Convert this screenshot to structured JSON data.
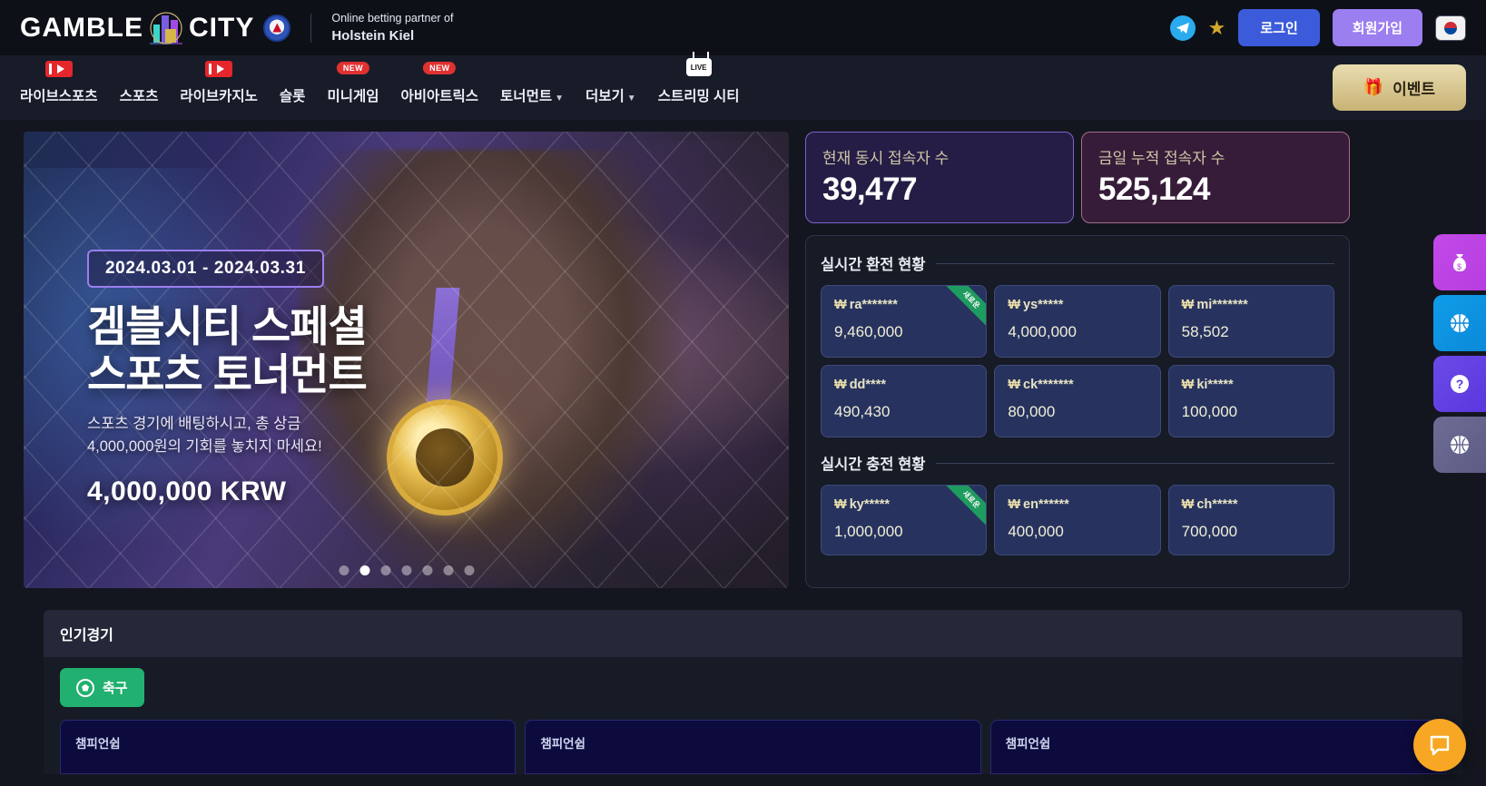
{
  "header": {
    "logo_text_1": "GAMBLE",
    "logo_text_2": "CITY",
    "logo_city_icon": "city-skyline-icon",
    "club_badge_icon": "holstein-kiel-badge-icon",
    "partner_line1": "Online betting partner of",
    "partner_line2": "Holstein Kiel",
    "telegram_icon": "telegram-icon",
    "star_icon": "star-icon",
    "login_label": "로그인",
    "signup_label": "회원가입",
    "flag_icon": "korea-flag-icon"
  },
  "nav": {
    "items": [
      {
        "label": "라이브스포츠",
        "badge": "",
        "badge_type": "youtube",
        "caret": false
      },
      {
        "label": "스포츠",
        "badge": "",
        "badge_type": "",
        "caret": false
      },
      {
        "label": "라이브카지노",
        "badge": "",
        "badge_type": "youtube",
        "caret": false
      },
      {
        "label": "슬롯",
        "badge": "",
        "badge_type": "",
        "caret": false
      },
      {
        "label": "미니게임",
        "badge": "NEW",
        "badge_type": "new",
        "caret": false
      },
      {
        "label": "아비아트릭스",
        "badge": "NEW",
        "badge_type": "new",
        "caret": false
      },
      {
        "label": "토너먼트",
        "badge": "",
        "badge_type": "",
        "caret": true
      },
      {
        "label": "더보기",
        "badge": "",
        "badge_type": "",
        "caret": true
      },
      {
        "label": "스트리밍 시티",
        "badge": "LIVE",
        "badge_type": "tv",
        "caret": false
      }
    ],
    "event_label": "이벤트",
    "event_icon": "gift-icon"
  },
  "banner": {
    "date_range": "2024.03.01 - 2024.03.31",
    "title_line1": "겜블시티 스페셜",
    "title_line2": "스포츠 토너먼트",
    "sub_line1": "스포츠 경기에 배팅하시고, 총 상금",
    "sub_line2": "4,000,000원의 기회를 놓치지 마세요!",
    "prize": "4,000,000 KRW",
    "dots_count": 7,
    "active_dot": 1
  },
  "stats": {
    "current": {
      "label": "현재 동시 접속자 수",
      "value": "39,477",
      "accent": "#7a63c8"
    },
    "today": {
      "label": "금일 누적 접속자 수",
      "value": "525,124",
      "accent": "#a46c8e"
    }
  },
  "withdraw": {
    "title": "실시간 환전 현황",
    "ribbon_label": "새로운",
    "items": [
      {
        "user": "ra*******",
        "amount": "9,460,000",
        "ribbon": true
      },
      {
        "user": "ys*****",
        "amount": "4,000,000",
        "ribbon": false
      },
      {
        "user": "mi*******",
        "amount": "58,502",
        "ribbon": false
      },
      {
        "user": "dd****",
        "amount": "490,430",
        "ribbon": false
      },
      {
        "user": "ck*******",
        "amount": "80,000",
        "ribbon": false
      },
      {
        "user": "ki*****",
        "amount": "100,000",
        "ribbon": false
      }
    ]
  },
  "deposit": {
    "title": "실시간 충전 현황",
    "ribbon_label": "새로운",
    "items": [
      {
        "user": "ky*****",
        "amount": "1,000,000",
        "ribbon": true
      },
      {
        "user": "en******",
        "amount": "400,000",
        "ribbon": false
      },
      {
        "user": "ch*****",
        "amount": "700,000",
        "ribbon": false
      }
    ]
  },
  "popular": {
    "title": "인기경기",
    "tab_label": "축구",
    "tab_icon": "soccer-ball-icon",
    "matches": [
      {
        "league": "챔피언쉽"
      },
      {
        "league": "챔피언쉽"
      },
      {
        "league": "챔피언쉽"
      }
    ]
  },
  "rail": {
    "buttons": [
      {
        "icon": "money-bag-icon",
        "glyph": "💰",
        "color": "#b63de0"
      },
      {
        "icon": "basketball-icon",
        "glyph": "🏀",
        "color": "#0b8ada"
      },
      {
        "icon": "question-mark-icon",
        "glyph": "?",
        "color": "#5a37dd"
      },
      {
        "icon": "globe-icon",
        "glyph": "🌐",
        "color": "#5d5c85"
      }
    ]
  },
  "chat": {
    "icon": "chat-bubble-icon"
  },
  "currency_symbol": "₩"
}
